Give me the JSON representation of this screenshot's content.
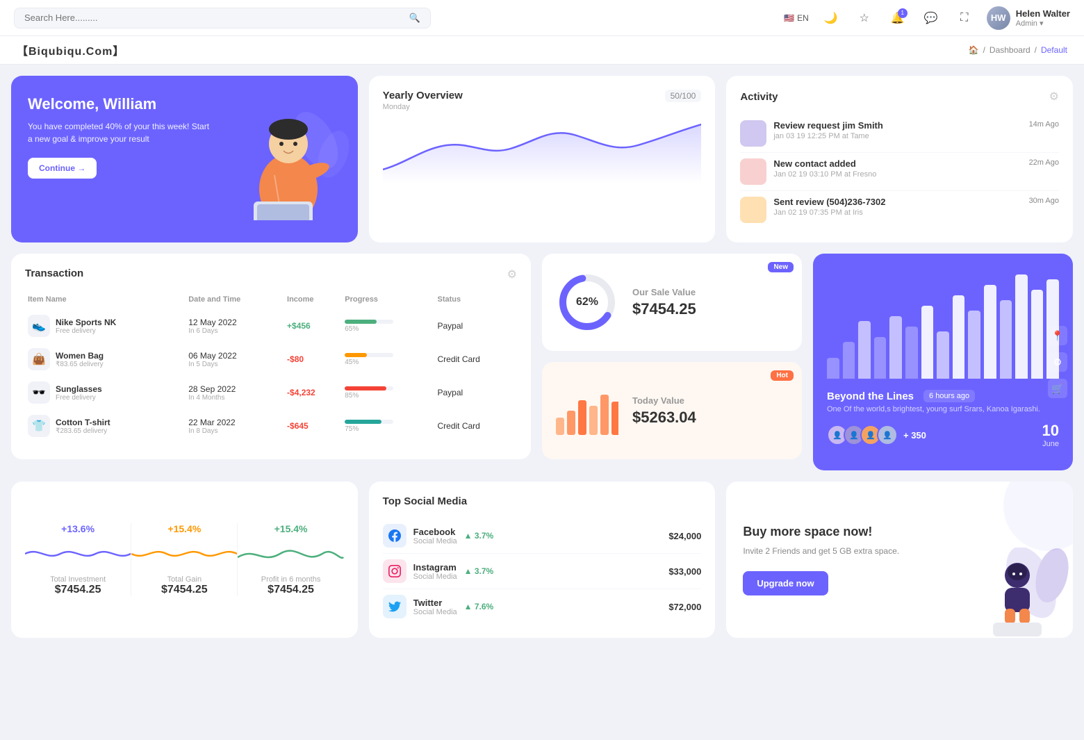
{
  "topnav": {
    "search_placeholder": "Search Here.........",
    "lang": "EN",
    "user": {
      "name": "Helen Walter",
      "role": "Admin",
      "initials": "HW"
    },
    "notif_count": "1"
  },
  "breadcrumb": {
    "brand": "【Biqubiqu.Com】",
    "home": "Home",
    "dashboard": "Dashboard",
    "current": "Default"
  },
  "welcome": {
    "title": "Welcome, William",
    "subtitle": "You have completed 40% of your this week! Start a new goal & improve your result",
    "button": "Continue →"
  },
  "yearly": {
    "title": "Yearly Overview",
    "subtitle": "Monday",
    "progress": "50/100"
  },
  "activity": {
    "title": "Activity",
    "items": [
      {
        "title": "Review request jim Smith",
        "sub": "jan 03 19 12:25 PM at Tame",
        "time": "14m Ago"
      },
      {
        "title": "New contact added",
        "sub": "Jan 02 19 03:10 PM at Fresno",
        "time": "22m Ago"
      },
      {
        "title": "Sent review (504)236-7302",
        "sub": "Jan 02 19 07:35 PM at Iris",
        "time": "30m Ago"
      }
    ]
  },
  "transaction": {
    "title": "Transaction",
    "headers": [
      "Item Name",
      "Date and Time",
      "Income",
      "Progress",
      "Status"
    ],
    "rows": [
      {
        "icon": "👟",
        "name": "Nike Sports NK",
        "sub": "Free delivery",
        "date": "12 May 2022",
        "days": "In 6 Days",
        "income": "+$456",
        "income_type": "pos",
        "progress": 65,
        "pb_class": "pb-green",
        "status": "Paypal"
      },
      {
        "icon": "👜",
        "name": "Women Bag",
        "sub": "₹83.65 delivery",
        "date": "06 May 2022",
        "days": "In 5 Days",
        "income": "-$80",
        "income_type": "neg",
        "progress": 45,
        "pb_class": "pb-orange",
        "status": "Credit Card"
      },
      {
        "icon": "🕶️",
        "name": "Sunglasses",
        "sub": "Free delivery",
        "date": "28 Sep 2022",
        "days": "In 4 Months",
        "income": "-$4,232",
        "income_type": "neg",
        "progress": 85,
        "pb_class": "pb-red",
        "status": "Paypal"
      },
      {
        "icon": "👕",
        "name": "Cotton T-shirt",
        "sub": "₹283.65 delivery",
        "date": "22 Mar 2022",
        "days": "In 8 Days",
        "income": "-$645",
        "income_type": "neg",
        "progress": 75,
        "pb_class": "pb-teal",
        "status": "Credit Card"
      }
    ]
  },
  "sale": {
    "badge": "New",
    "percent": "62%",
    "label": "Our Sale Value",
    "value": "$7454.25"
  },
  "today": {
    "badge": "Hot",
    "label": "Today Value",
    "value": "$5263.04"
  },
  "barchart": {
    "title": "Beyond the Lines",
    "time_ago": "6 hours ago",
    "desc": "One Of the world,s brightest, young surf Srars, Kanoa Igarashi.",
    "count": "+ 350",
    "date_num": "10",
    "date_month": "June",
    "bars": [
      20,
      35,
      55,
      40,
      60,
      50,
      70,
      45,
      80,
      65,
      90,
      75,
      100,
      85,
      95
    ]
  },
  "stats": [
    {
      "percent": "+13.6%",
      "label": "Total Investment",
      "value": "$7454.25",
      "color": "#6c63ff"
    },
    {
      "percent": "+15.4%",
      "label": "Total Gain",
      "value": "$7454.25",
      "color": "#ff9800"
    },
    {
      "percent": "+15.4%",
      "label": "Profit in 6 months",
      "value": "$7454.25",
      "color": "#4caf7d"
    }
  ],
  "social": {
    "title": "Top Social Media",
    "items": [
      {
        "name": "Facebook",
        "sub": "Social Media",
        "growth": "3.7%",
        "value": "$24,000",
        "icon": "f",
        "bg_class": "fb-bg"
      },
      {
        "name": "Instagram",
        "sub": "Social Media",
        "growth": "3.7%",
        "value": "$33,000",
        "icon": "ig",
        "bg_class": "ig-bg"
      },
      {
        "name": "Twitter",
        "sub": "Social Media",
        "growth": "7.6%",
        "value": "$72,000",
        "icon": "tw",
        "bg_class": "tw-bg"
      }
    ]
  },
  "upgrade": {
    "title": "Buy more space now!",
    "sub": "Invite 2 Friends and get 5 GB extra space.",
    "button": "Upgrade now"
  }
}
